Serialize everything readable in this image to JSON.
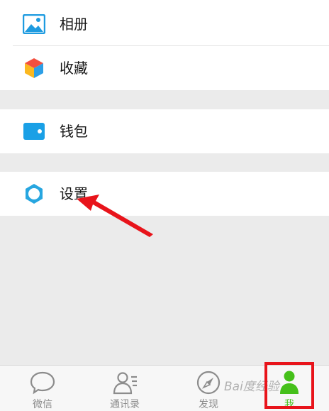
{
  "menu": {
    "album_label": "相册",
    "favorites_label": "收藏",
    "wallet_label": "钱包",
    "settings_label": "设置"
  },
  "tabbar": {
    "tabs": [
      {
        "label": "微信",
        "icon": "chat-bubble-icon"
      },
      {
        "label": "通讯录",
        "icon": "contacts-icon"
      },
      {
        "label": "发现",
        "icon": "compass-icon"
      },
      {
        "label": "我",
        "icon": "person-icon",
        "active": true
      }
    ]
  },
  "watermark": "Bai度经验",
  "colors": {
    "accent_green": "#45c01a",
    "annotation_red": "#e8141b",
    "wallet_blue": "#1aa0e6",
    "settings_blue": "#27a6e0"
  }
}
